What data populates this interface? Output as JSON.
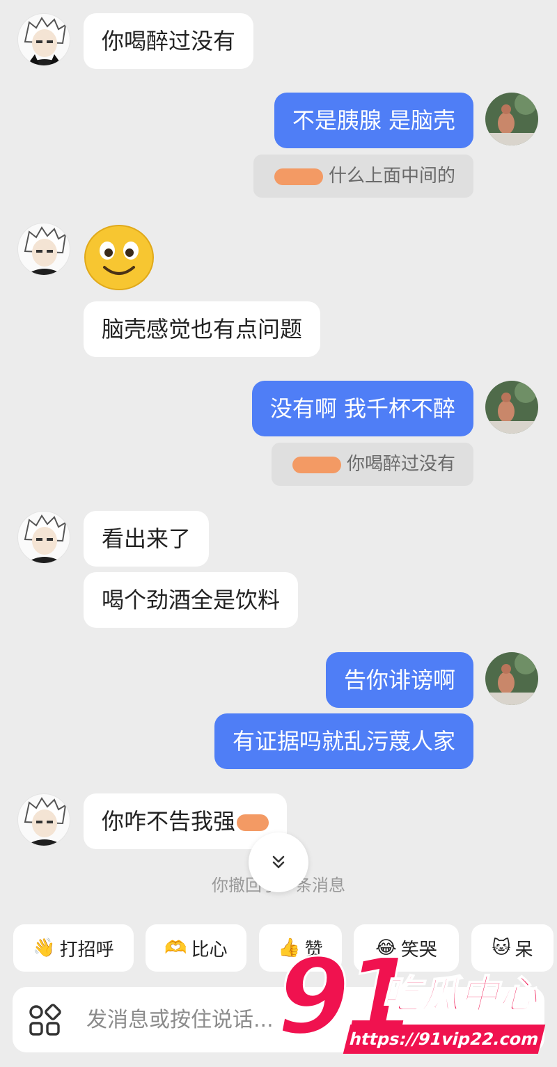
{
  "messages": {
    "m1": "你喝醉过没有",
    "m2": "不是胰腺 是脑壳",
    "q1": "什么上面中间的",
    "m3": "脑壳感觉也有点问题",
    "m4": "没有啊 我千杯不醉",
    "q2": "你喝醉过没有",
    "m5": "看出来了",
    "m6": "喝个劲酒全是饮料",
    "m7": "告你诽谤啊",
    "m8": "有证据吗就乱污蔑人家",
    "m9": "你咋不告我强"
  },
  "recall_notice": "你撤回了一条消息",
  "quick_replies": [
    {
      "label": "打招呼",
      "icon": "waving-hand-icon"
    },
    {
      "label": "比心",
      "icon": "heart-hands-icon"
    },
    {
      "label": "赞",
      "icon": "thumbs-up-icon"
    },
    {
      "label": "笑哭",
      "icon": "tears-of-joy-icon"
    },
    {
      "label": "呆",
      "icon": "dazed-cat-icon"
    }
  ],
  "input": {
    "placeholder": "发消息或按住说话..."
  },
  "watermark": {
    "number": "91",
    "text": "吃瓜中心",
    "url": "https://91vip22.com"
  },
  "colors": {
    "outgoing_bubble": "#4f7ef6",
    "background": "#ececec",
    "watermark": "#f0124f"
  }
}
